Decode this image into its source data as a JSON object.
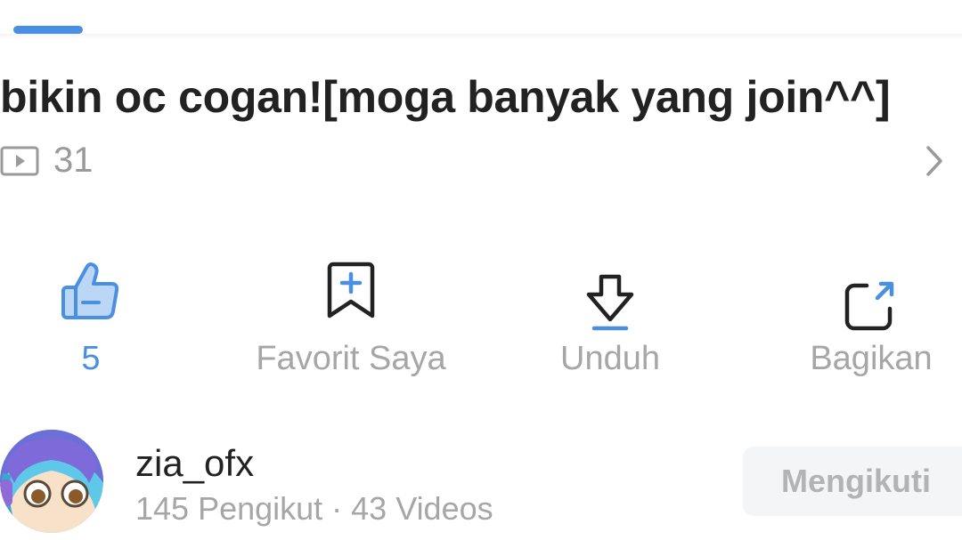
{
  "video": {
    "title": "bikin oc cogan![moga banyak yang join^^]",
    "play_count": "31"
  },
  "actions": {
    "like_count": "5",
    "favorite_label": "Favorit Saya",
    "download_label": "Unduh",
    "share_label": "Bagikan"
  },
  "author": {
    "name": "zia_ofx",
    "stats": "145 Pengikut · 43 Videos",
    "follow_label": "Mengikuti"
  },
  "colors": {
    "accent": "#4a90e2",
    "title_text": "#222222",
    "secondary_text": "#a6a6a6",
    "follow_bg": "#f4f5f7"
  },
  "icons": {
    "play_count": "play-icon",
    "chevron": "chevron-right-icon",
    "like": "thumbs-up-icon",
    "favorite": "bookmark-plus-icon",
    "download": "download-arrow-icon",
    "share": "share-icon"
  }
}
